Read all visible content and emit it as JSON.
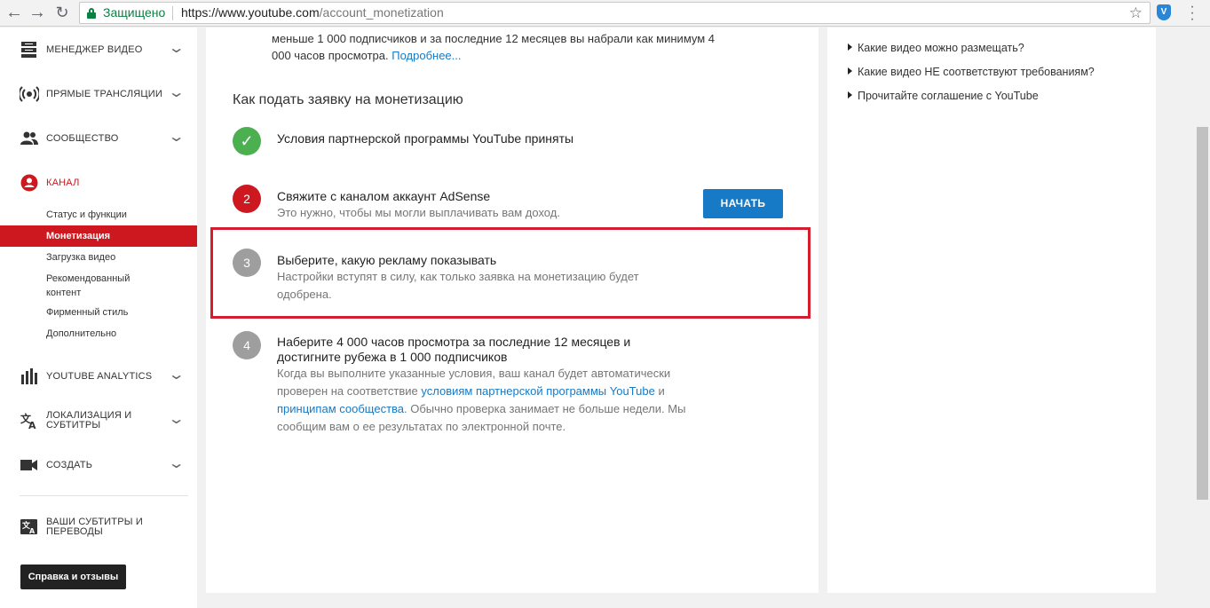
{
  "browser": {
    "secure_label": "Защищено",
    "url_host": "https://www.youtube.com",
    "url_path": "/account_monetization"
  },
  "sidebar": {
    "items": [
      {
        "label": "МЕНЕДЖЕР ВИДЕО",
        "icon": "video-manager-icon"
      },
      {
        "label": "ПРЯМЫЕ ТРАНСЛЯЦИИ",
        "icon": "live-broadcast-icon"
      },
      {
        "label": "СООБЩЕСТВО",
        "icon": "community-icon"
      },
      {
        "label": "КАНАЛ",
        "icon": "channel-icon",
        "color": "#cc181e"
      },
      {
        "label": "YOUTUBE ANALYTICS",
        "icon": "analytics-icon"
      },
      {
        "label": "ЛОКАЛИЗАЦИЯ И\nСУБТИТРЫ",
        "icon": "translate-icon"
      },
      {
        "label": "СОЗДАТЬ",
        "icon": "camera-icon"
      },
      {
        "label": "ВАШИ СУБТИТРЫ И\nПЕРЕВОДЫ",
        "icon": "subtitles-icon"
      }
    ],
    "channel_sub": [
      "Статус и функции",
      "Монетизация",
      "Загрузка видео",
      "Рекомендованный\nконтент",
      "Фирменный стиль",
      "Дополнительно"
    ],
    "help_button": "Справка и отзывы"
  },
  "main": {
    "intro_text": "меньше 1 000 подписчиков и за последние 12 месяцев вы набрали как минимум 4 000 часов просмотра.",
    "intro_link": "Подробнее...",
    "section_title": "Как подать заявку на монетизацию",
    "steps": [
      {
        "marker": "✓",
        "title": "Условия партнерской программы YouTube приняты",
        "status": "done",
        "color": "#4caf50"
      },
      {
        "marker": "2",
        "title": "Свяжите с каналом аккаунт AdSense",
        "desc": "Это нужно, чтобы мы могли выплачивать вам доход.",
        "color": "#cc181e"
      },
      {
        "marker": "3",
        "title": "Выберите, какую рекламу показывать",
        "desc": "Настройки вступят в силу, как только заявка на монетизацию будет одобрена.",
        "color": "#9e9e9e"
      },
      {
        "marker": "4",
        "title": "Наберите 4 000 часов просмотра за последние 12 месяцев и достигните рубежа в 1 000 подписчиков",
        "desc_pre": "Когда вы выполните указанные условия, ваш канал будет автоматически проверен на соответствие",
        "desc_link1": "условиям партнерской программы YouTube",
        "desc_and": "и",
        "desc_link2": "принципам сообщества",
        "desc_post": ". Обычно проверка занимает не больше недели. Мы сообщим вам о ее результатах по электронной почте.",
        "color": "#9e9e9e"
      }
    ],
    "start_button": "НАЧАТЬ"
  },
  "right_panel": {
    "links": [
      "Какие видео можно размещать?",
      "Какие видео НЕ соответствуют требованиям?",
      "Прочитайте соглашение с YouTube"
    ]
  }
}
